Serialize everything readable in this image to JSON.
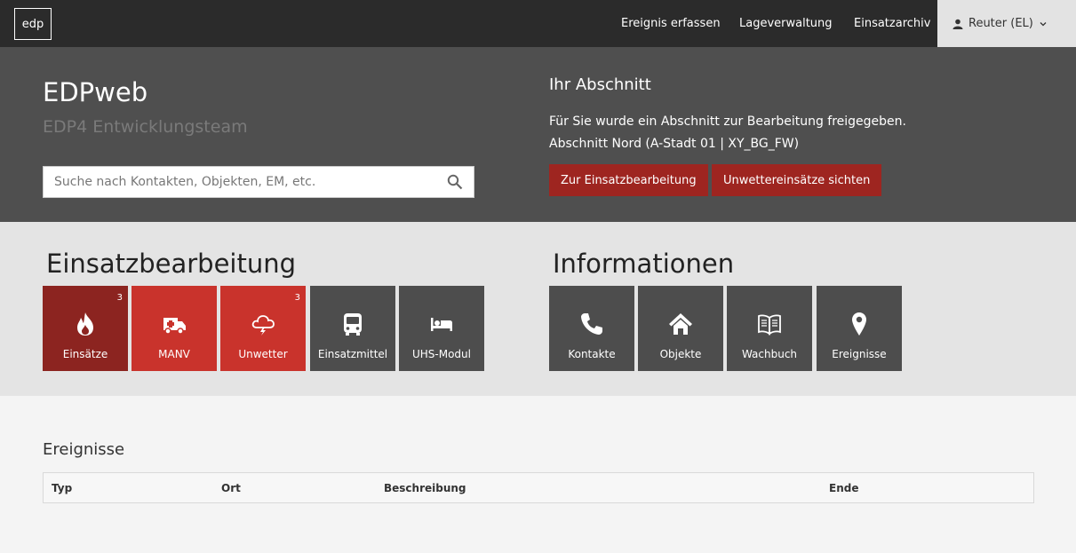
{
  "navbar": {
    "logo": "edp",
    "links": [
      "Ereignis erfassen",
      "Lageverwaltung",
      "Einsatzarchiv"
    ],
    "user_label": "Reuter (EL)"
  },
  "hero": {
    "title": "EDPweb",
    "subtitle": "EDP4 Entwicklungsteam",
    "search_placeholder": "Suche nach Kontakten, Objekten, EM, etc.",
    "section": {
      "title": "Ihr Abschnitt",
      "line1": "Für Sie wurde ein Abschnitt zur Bearbeitung freigegeben.",
      "line2": "Abschnitt Nord (A-Stadt 01 | XY_BG_FW)",
      "btn_edit": "Zur Einsatzbearbeitung",
      "btn_storm": "Unwettereinsätze sichten"
    }
  },
  "einsatz": {
    "title": "Einsatzbearbeitung",
    "tiles": [
      {
        "label": "Einsätze",
        "badge": "3",
        "icon": "fire-icon"
      },
      {
        "label": "MANV",
        "badge": "",
        "icon": "ambulance-icon"
      },
      {
        "label": "Unwetter",
        "badge": "3",
        "icon": "storm-cloud-icon"
      },
      {
        "label": "Einsatzmittel",
        "badge": "",
        "icon": "vehicle-icon"
      },
      {
        "label": "UHS-Modul",
        "badge": "",
        "icon": "bed-icon"
      }
    ]
  },
  "info": {
    "title": "Informationen",
    "tiles": [
      {
        "label": "Kontakte",
        "icon": "phone-icon"
      },
      {
        "label": "Objekte",
        "icon": "home-icon"
      },
      {
        "label": "Wachbuch",
        "icon": "book-icon"
      },
      {
        "label": "Ereignisse",
        "icon": "map-marker-icon"
      }
    ]
  },
  "events": {
    "title": "Ereignisse",
    "columns": [
      "Typ",
      "Ort",
      "Beschreibung",
      "Ende"
    ]
  },
  "colors": {
    "navbar": "#2b2b2b",
    "hero": "#4f4f4f",
    "accent_red": "#9e2520",
    "tile_dark_red": "#8c2420",
    "tile_red": "#c9332c",
    "tile_gray": "#4d4d4d"
  }
}
